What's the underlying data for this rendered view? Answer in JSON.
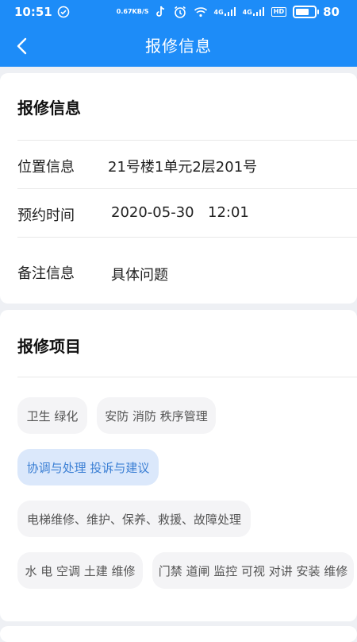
{
  "status_bar": {
    "time": "10:51",
    "net_speed_value": "0.67",
    "net_speed_unit": "KB/S",
    "network_1": "4G",
    "network_2": "4G",
    "hd_label": "HD",
    "battery": "80"
  },
  "nav": {
    "title": "报修信息"
  },
  "repair_info": {
    "title": "报修信息",
    "location_label": "位置信息",
    "location_value": "21号楼1单元2层201号",
    "time_label": "预约时间",
    "date_value": "2020-05-30",
    "time_value": "12:01",
    "note_label": "备注信息",
    "note_value": "具体问题"
  },
  "repair_items": {
    "title": "报修项目",
    "tags": [
      {
        "label": "卫生 绿化",
        "selected": false
      },
      {
        "label": "安防 消防 秩序管理",
        "selected": false
      },
      {
        "label": "协调与处理 投诉与建议",
        "selected": true
      },
      {
        "label": "电梯维修、维护、保养、救援、故障处理",
        "selected": false
      },
      {
        "label": "水 电 空调 土建 维修",
        "selected": false
      },
      {
        "label": "门禁 道闸 监控 可视 对讲 安装 维修",
        "selected": false
      }
    ]
  },
  "colors": {
    "primary": "#1d8cf8",
    "selected_tag_bg": "#dbe8fb",
    "selected_tag_text": "#3b7fd4",
    "tag_bg": "#f4f4f6"
  }
}
